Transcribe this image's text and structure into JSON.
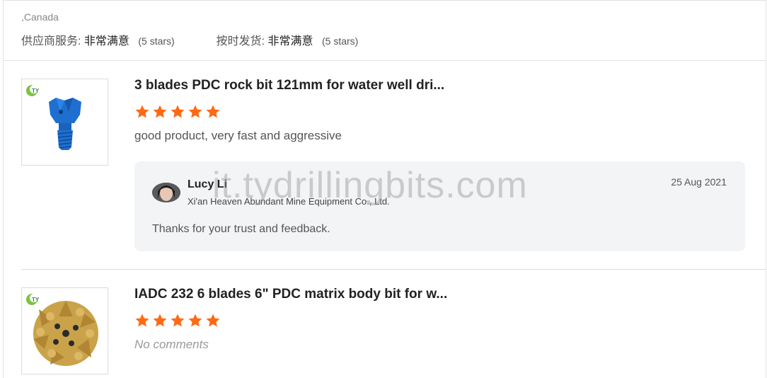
{
  "header": {
    "country": ",Canada",
    "supplier_service_label": "供应商服务:",
    "supplier_service_value": "非常满意",
    "supplier_service_stars": "(5 stars)",
    "delivery_label": "按时发货:",
    "delivery_value": "非常满意",
    "delivery_stars": "(5 stars)"
  },
  "reviews": [
    {
      "title": "3 blades PDC rock bit 121mm for water well dri...",
      "rating": 5,
      "comment": "good product, very fast and aggressive",
      "reply": {
        "name": "Lucy Li",
        "company": "Xi'an Heaven Abundant Mine Equipment Co., Ltd.",
        "date": "25 Aug 2021",
        "text": "Thanks for your trust and feedback."
      }
    },
    {
      "title": "IADC 232 6 blades 6\" PDC matrix body bit for w...",
      "rating": 5,
      "comment": "No comments"
    }
  ],
  "watermark": "it.tydrillingbits.com",
  "colors": {
    "star": "#ff6a13",
    "reply_bg": "#f3f4f6",
    "product_blue": "#1e6fd0",
    "product_gold": "#c9a24a"
  },
  "icons": {
    "star": "star-icon",
    "brand": "brand-logo-icon"
  }
}
